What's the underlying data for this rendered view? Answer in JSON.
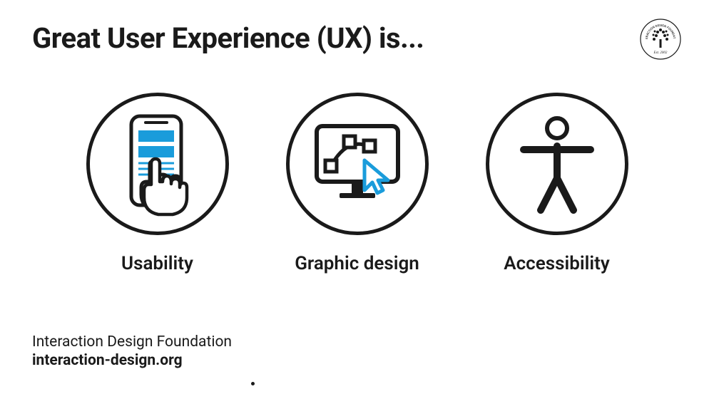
{
  "title": "Great User Experience (UX) is...",
  "logo": {
    "text_top": "INTERACTION DESIGN FOUNDATION",
    "text_bottom": "Est. 2002"
  },
  "cards": [
    {
      "label": "Usability",
      "icon": "phone-touch-icon"
    },
    {
      "label": "Graphic design",
      "icon": "monitor-cursor-icon"
    },
    {
      "label": "Accessibility",
      "icon": "person-icon"
    }
  ],
  "footer": {
    "org": "Interaction Design Foundation",
    "url": "interaction-design.org"
  },
  "colors": {
    "accent": "#1a9cdb",
    "text": "#1a1a1a"
  }
}
